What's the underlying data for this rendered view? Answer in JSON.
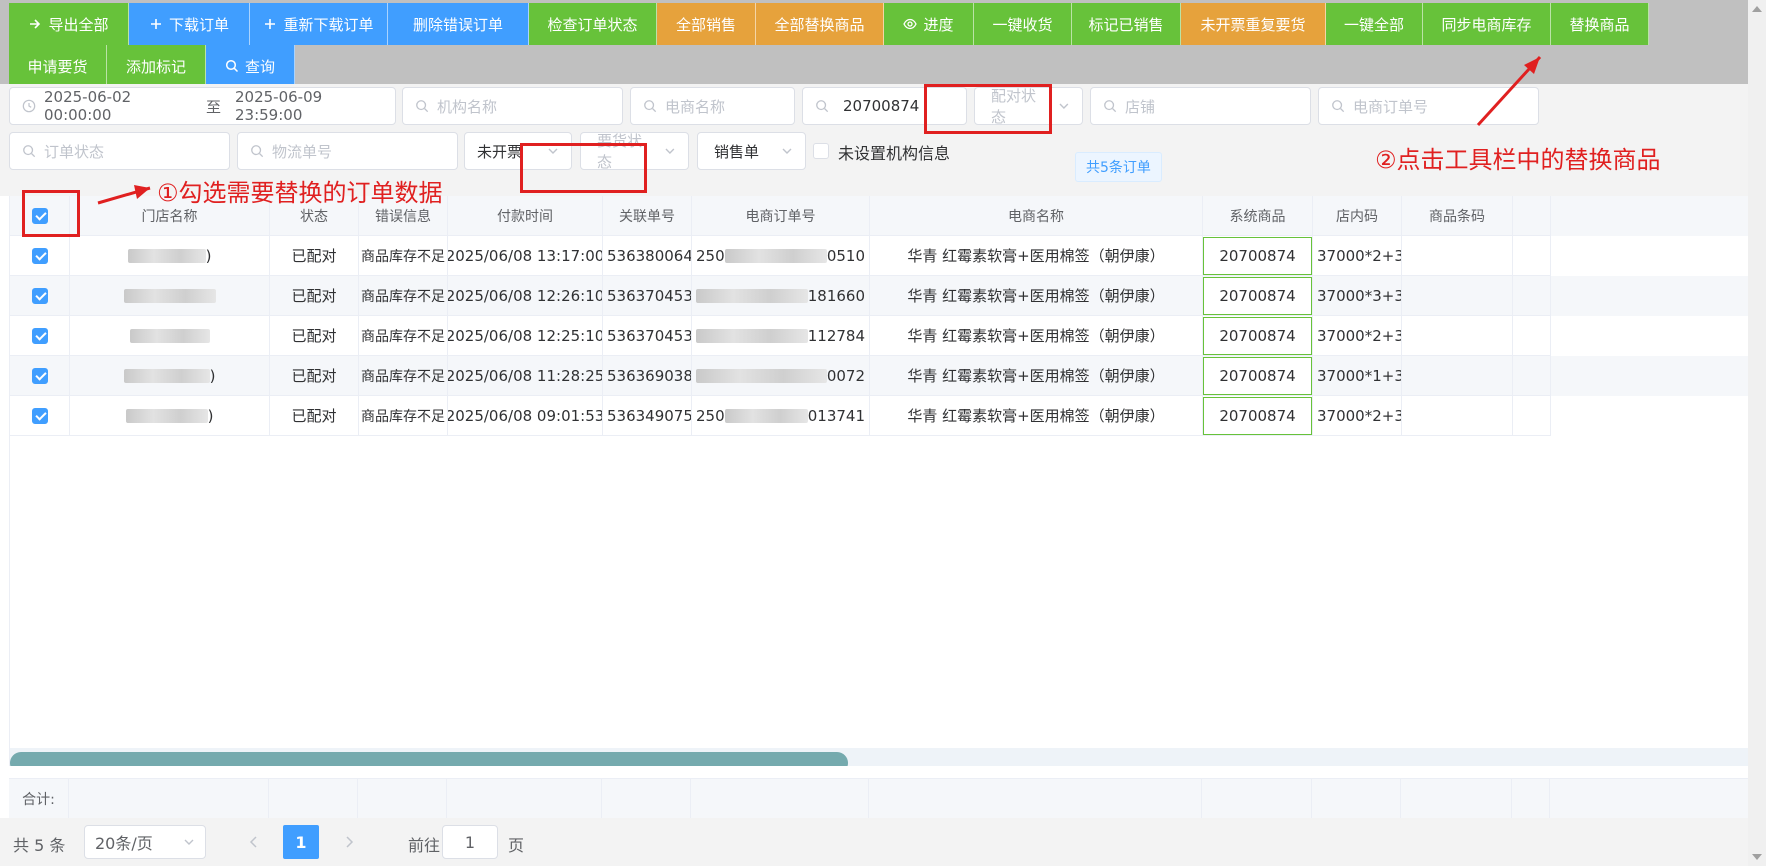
{
  "toolbar": {
    "row1": [
      {
        "label": "导出全部",
        "icon": "arrow-right-icon",
        "color": "green"
      },
      {
        "label": "下载订单",
        "icon": "plus-icon",
        "color": "blue"
      },
      {
        "label": "重新下载订单",
        "icon": "plus-icon",
        "color": "blue"
      },
      {
        "label": "删除错误订单",
        "icon": "",
        "color": "blue"
      },
      {
        "label": "检查订单状态",
        "icon": "",
        "color": "green"
      },
      {
        "label": "全部销售",
        "icon": "",
        "color": "orange"
      },
      {
        "label": "全部替换商品",
        "icon": "",
        "color": "orange"
      },
      {
        "label": "进度",
        "icon": "eye-icon",
        "color": "green"
      },
      {
        "label": "一键收货",
        "icon": "",
        "color": "green"
      },
      {
        "label": "标记已销售",
        "icon": "",
        "color": "green"
      },
      {
        "label": "未开票重复要货",
        "icon": "",
        "color": "orange"
      },
      {
        "label": "一键全部",
        "icon": "",
        "color": "green"
      },
      {
        "label": "同步电商库存",
        "icon": "",
        "color": "green"
      },
      {
        "label": "替换商品",
        "icon": "",
        "color": "green"
      }
    ],
    "row2": [
      {
        "label": "申请要货",
        "icon": "",
        "color": "green"
      },
      {
        "label": "添加标记",
        "icon": "",
        "color": "green"
      },
      {
        "label": "查询",
        "icon": "search-icon",
        "color": "blue"
      }
    ]
  },
  "filters": {
    "date_start": "2025-06-02 00:00:00",
    "date_sep": "至",
    "date_end": "2025-06-09 23:59:00",
    "org_placeholder": "机构名称",
    "ecom_name_placeholder": "电商名称",
    "product_value": "20700874",
    "match_status_placeholder": "配对状态",
    "shop_placeholder": "店铺",
    "ecom_order_placeholder": "电商订单号",
    "order_status_placeholder": "订单状态",
    "logistics_placeholder": "物流单号",
    "invoice_value": "未开票",
    "request_status_placeholder": "要货状态",
    "order_type_value": "销售单",
    "no_org_label": "未设置机构信息",
    "count_tag": "共5条订单"
  },
  "annotations": {
    "step1": "①勾选需要替换的订单数据",
    "step2": "②点击工具栏中的替换商品"
  },
  "table": {
    "columns": [
      "门店名称",
      "状态",
      "错误信息",
      "付款时间",
      "关联单号",
      "电商订单号",
      "电商名称",
      "系统商品",
      "店内码",
      "商品条码"
    ],
    "rows": [
      {
        "store_tail": ")",
        "status": "已配对",
        "error": "商品库存不足",
        "pay_time": "2025/06/08 13:17:00",
        "ref": "536380064...",
        "order_head": "250",
        "order_tail": "0510",
        "ecom_name": "华青 红霉素软膏+医用棉签（朝伊康）",
        "sys_product": "20700874",
        "store_code": "37000*2+3...",
        "barcode": ""
      },
      {
        "store_tail": "",
        "status": "已配对",
        "error": "商品库存不足",
        "pay_time": "2025/06/08 12:26:10",
        "ref": "536370453...",
        "order_head": "",
        "order_tail": "181660",
        "ecom_name": "华青 红霉素软膏+医用棉签（朝伊康）",
        "sys_product": "20700874",
        "store_code": "37000*3+3...",
        "barcode": ""
      },
      {
        "store_tail": "",
        "status": "已配对",
        "error": "商品库存不足",
        "pay_time": "2025/06/08 12:25:10",
        "ref": "536370453...",
        "order_head": "",
        "order_tail": "112784",
        "ecom_name": "华青 红霉素软膏+医用棉签（朝伊康）",
        "sys_product": "20700874",
        "store_code": "37000*2+3...",
        "barcode": ""
      },
      {
        "store_tail": ")",
        "status": "已配对",
        "error": "商品库存不足",
        "pay_time": "2025/06/08 11:28:25",
        "ref": "536369038...",
        "order_head": "",
        "order_tail": "0072",
        "ecom_name": "华青 红霉素软膏+医用棉签（朝伊康）",
        "sys_product": "20700874",
        "store_code": "37000*1+3...",
        "barcode": ""
      },
      {
        "store_tail": ")",
        "status": "已配对",
        "error": "商品库存不足",
        "pay_time": "2025/06/08 09:01:53",
        "ref": "536349075...",
        "order_head": "250",
        "order_tail": "013741",
        "ecom_name": "华青 红霉素软膏+医用棉签（朝伊康）",
        "sys_product": "20700874",
        "store_code": "37000*2+3...",
        "barcode": ""
      }
    ],
    "summary_label": "合计:"
  },
  "pager": {
    "total": "共 5 条",
    "page_size": "20条/页",
    "current": "1",
    "goto_label": "前往",
    "goto_value": "1",
    "page_unit": "页"
  },
  "colors": {
    "green": "#67c23a",
    "blue": "#409eff",
    "orange": "#e6a23c",
    "annotation_red": "#e02020"
  }
}
